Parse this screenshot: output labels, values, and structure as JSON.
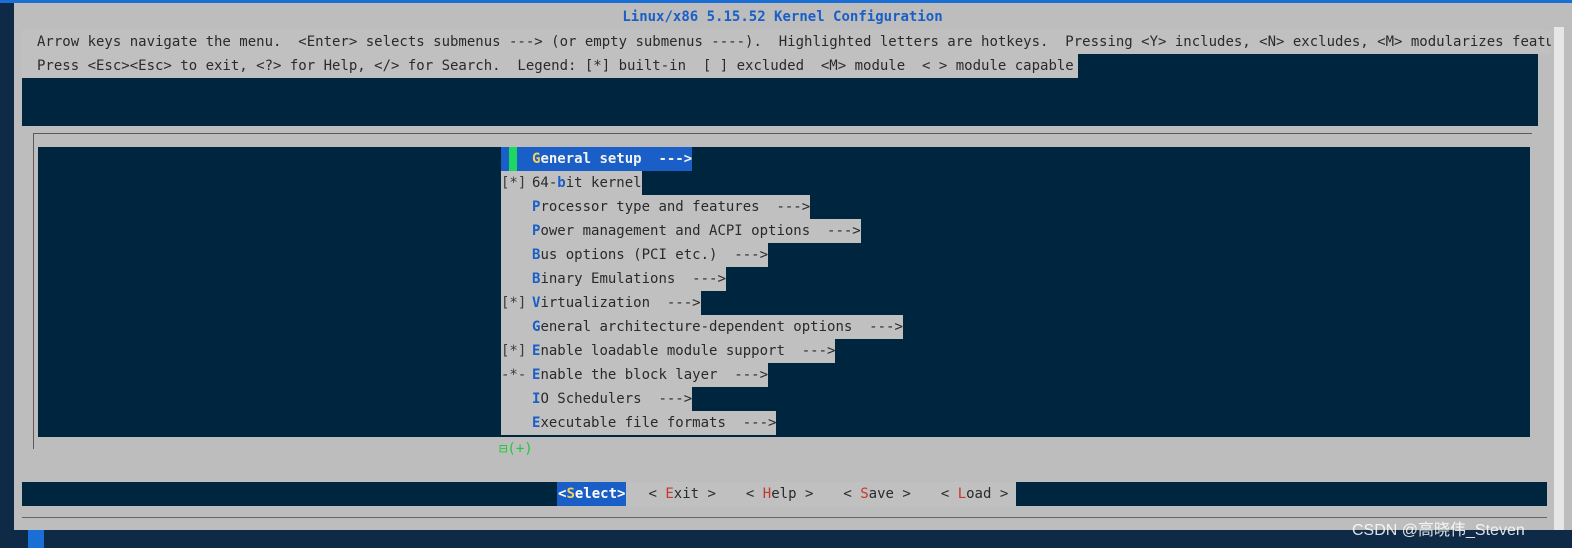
{
  "title": "Linux/x86 5.15.52 Kernel Configuration",
  "help_lines": [
    "Arrow keys navigate the menu.  <Enter> selects submenus ---> (or empty submenus ----).  Highlighted letters are hotkeys.  Pressing <Y> includes, <N> excludes, <M> modularizes features.",
    "Press <Esc><Esc> to exit, <?> for Help, </> for Search.  Legend: [*] built-in  [ ] excluded  <M> module  < > module capable"
  ],
  "menu_items": [
    {
      "prefix": "",
      "hotkey": "G",
      "rest": "eneral setup  --->",
      "selected": true
    },
    {
      "prefix": "[*]",
      "hotkey": "",
      "rest": "64-bit kernel",
      "inner_hotkey": {
        "before": "64-",
        "key": "b",
        "after": "it kernel"
      },
      "selected": false
    },
    {
      "prefix": "",
      "hotkey": "P",
      "rest": "rocessor type and features  --->",
      "selected": false
    },
    {
      "prefix": "",
      "hotkey": "P",
      "rest": "ower management and ACPI options  --->",
      "selected": false
    },
    {
      "prefix": "",
      "hotkey": "B",
      "rest": "us options (PCI etc.)  --->",
      "selected": false
    },
    {
      "prefix": "",
      "hotkey": "B",
      "rest": "inary Emulations  --->",
      "selected": false
    },
    {
      "prefix": "[*]",
      "hotkey": "V",
      "rest": "irtualization  --->",
      "selected": false
    },
    {
      "prefix": "",
      "hotkey": "G",
      "rest": "eneral architecture-dependent options  --->",
      "selected": false
    },
    {
      "prefix": "[*]",
      "hotkey": "E",
      "rest": "nable loadable module support  --->",
      "selected": false
    },
    {
      "prefix": "-*-",
      "hotkey": "E",
      "rest": "nable the block layer  --->",
      "selected": false
    },
    {
      "prefix": "",
      "hotkey": "I",
      "rest": "O Schedulers  --->",
      "selected": false
    },
    {
      "prefix": "",
      "hotkey": "E",
      "rest": "xecutable file formats  --->",
      "selected": false
    }
  ],
  "more_indicator": "⊟(+)",
  "buttons": [
    {
      "open": "<",
      "hotkey": "S",
      "rest": "elect",
      "close": ">",
      "selected": true
    },
    {
      "open": "< ",
      "hotkey": "E",
      "rest": "xit",
      "close": " >",
      "selected": false
    },
    {
      "open": "< ",
      "hotkey": "H",
      "rest": "elp",
      "close": " >",
      "selected": false
    },
    {
      "open": "< ",
      "hotkey": "S",
      "rest": "ave",
      "close": " >",
      "selected": false
    },
    {
      "open": "< ",
      "hotkey": "L",
      "rest": "oad",
      "close": " >",
      "selected": false
    }
  ],
  "watermark": "CSDN @高晓伟_Steven",
  "colors": {
    "background": "#bdbdbd",
    "panel": "#00253f",
    "accent": "#1a5fc7",
    "hotkey_button": "#c8372d",
    "cursor": "#1ed760"
  }
}
